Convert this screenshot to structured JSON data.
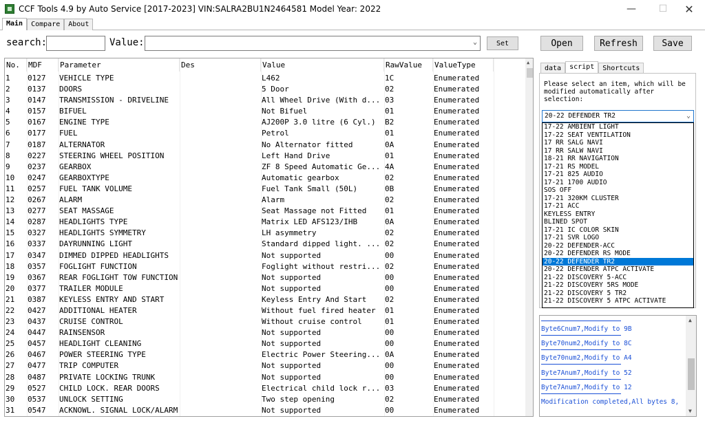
{
  "window": {
    "title": "CCF Tools 4.9 by Auto Service [2017-2023]   VIN:SALRA2BU1N2464581  Model Year: 2022"
  },
  "tabs": [
    "Main",
    "Compare",
    "About"
  ],
  "search": {
    "label": "search:",
    "value": ""
  },
  "value_filter": {
    "label": "Value:",
    "value": ""
  },
  "buttons": {
    "set": "Set",
    "open": "Open",
    "refresh": "Refresh",
    "save": "Save"
  },
  "grid": {
    "columns": [
      "No.",
      "MDF",
      "Parameter",
      "Des",
      "Value",
      "RawValue",
      "ValueType"
    ],
    "rows": [
      [
        "1",
        "0127",
        "VEHICLE TYPE",
        "",
        "L462",
        "1C",
        "Enumerated"
      ],
      [
        "2",
        "0137",
        "DOORS",
        "",
        "5 Door",
        "02",
        "Enumerated"
      ],
      [
        "3",
        "0147",
        "TRANSMISSION  - DRIVELINE",
        "",
        "All Wheel Drive (With d...",
        "03",
        "Enumerated"
      ],
      [
        "4",
        "0157",
        "BIFUEL",
        "",
        "Not Bifuel",
        "01",
        "Enumerated"
      ],
      [
        "5",
        "0167",
        "ENGINE TYPE",
        "",
        "AJ200P 3.0 litre (6 Cyl.)",
        "B2",
        "Enumerated"
      ],
      [
        "6",
        "0177",
        "FUEL",
        "",
        "Petrol",
        "01",
        "Enumerated"
      ],
      [
        "7",
        "0187",
        "ALTERNATOR",
        "",
        "No Alternator fitted",
        "0A",
        "Enumerated"
      ],
      [
        "8",
        "0227",
        "STEERING WHEEL POSITION",
        "",
        "Left Hand Drive",
        "01",
        "Enumerated"
      ],
      [
        "9",
        "0237",
        "GEARBOX",
        "",
        "ZF 8 Speed Automatic Ge...",
        "4A",
        "Enumerated"
      ],
      [
        "10",
        "0247",
        "GEARBOXTYPE",
        "",
        "Automatic gearbox",
        "02",
        "Enumerated"
      ],
      [
        "11",
        "0257",
        "FUEL TANK VOLUME",
        "",
        "Fuel Tank Small (50L)",
        "0B",
        "Enumerated"
      ],
      [
        "12",
        "0267",
        "ALARM",
        "",
        "Alarm",
        "02",
        "Enumerated"
      ],
      [
        "13",
        "0277",
        "SEAT MASSAGE",
        "",
        "Seat Massage not Fitted",
        "01",
        "Enumerated"
      ],
      [
        "14",
        "0287",
        "HEADLIGHTS TYPE",
        "",
        "Matrix LED AFS123/IHB",
        "0A",
        "Enumerated"
      ],
      [
        "15",
        "0327",
        "HEADLIGHTS SYMMETRY",
        "",
        "LH asymmetry",
        "02",
        "Enumerated"
      ],
      [
        "16",
        "0337",
        "DAYRUNNING LIGHT",
        "",
        "Standard dipped light. ...",
        "02",
        "Enumerated"
      ],
      [
        "17",
        "0347",
        "DIMMED DIPPED HEADLIGHTS",
        "",
        "Not supported",
        "00",
        "Enumerated"
      ],
      [
        "18",
        "0357",
        "FOGLIGHT FUNCTION",
        "",
        "Foglight without restri...",
        "02",
        "Enumerated"
      ],
      [
        "19",
        "0367",
        "REAR FOGLIGHT TOW FUNCTION",
        "",
        "Not supported",
        "00",
        "Enumerated"
      ],
      [
        "20",
        "0377",
        "TRAILER MODULE",
        "",
        "Not supported",
        "00",
        "Enumerated"
      ],
      [
        "21",
        "0387",
        "KEYLESS ENTRY AND START",
        "",
        "Keyless Entry And Start",
        "02",
        "Enumerated"
      ],
      [
        "22",
        "0427",
        "ADDITIONAL HEATER",
        "",
        "Without fuel fired heater",
        "01",
        "Enumerated"
      ],
      [
        "23",
        "0437",
        "CRUISE CONTROL",
        "",
        "Without cruise control",
        "01",
        "Enumerated"
      ],
      [
        "24",
        "0447",
        "RAINSENSOR",
        "",
        "Not supported",
        "00",
        "Enumerated"
      ],
      [
        "25",
        "0457",
        "HEADLIGHT CLEANING",
        "",
        "Not supported",
        "00",
        "Enumerated"
      ],
      [
        "26",
        "0467",
        "POWER STEERING TYPE",
        "",
        "Electric Power Steering...",
        "0A",
        "Enumerated"
      ],
      [
        "27",
        "0477",
        "TRIP COMPUTER",
        "",
        "Not supported",
        "00",
        "Enumerated"
      ],
      [
        "28",
        "0487",
        "PRIVATE LOCKING TRUNK",
        "",
        "Not supported",
        "00",
        "Enumerated"
      ],
      [
        "29",
        "0527",
        "CHILD LOCK. REAR DOORS",
        "",
        "Electrical child lock r...",
        "03",
        "Enumerated"
      ],
      [
        "30",
        "0537",
        "UNLOCK SETTING",
        "",
        "Two step opening",
        "02",
        "Enumerated"
      ],
      [
        "31",
        "0547",
        "ACKNOWL. SIGNAL LOCK/ALARM",
        "",
        "Not supported",
        "00",
        "Enumerated"
      ]
    ]
  },
  "right_tabs": [
    "data",
    "script",
    "Shortcuts"
  ],
  "script": {
    "instruction": "Please select an item, which will be\nmodified automatically after\nselection:",
    "selected": "20-22 DEFENDER TR2",
    "options": [
      "17-22 AMBIENT LIGHT",
      "17-22 SEAT VENTILATION",
      "17 RR SALG NAVI",
      "17 RR SALW NAVI",
      "18-21 RR NAVIGATION",
      "17-21 RS MODEL",
      "17-21 825 AUDIO",
      "17-21 1700 AUDIO",
      "SOS OFF",
      "17-21 320KM CLUSTER",
      "17-21 ACC",
      "KEYLESS ENTRY",
      "BLINED SPOT",
      "17-21 IC COLOR SKIN",
      "17-21 SVR LOGO",
      "20-22 DEFENDER-ACC",
      "20-22 DEFENDER RS MODE",
      "20-22 DEFENDER TR2",
      "20-22 DEFENDER ATPC ACTIVATE",
      "21-22 DISCOVERY 5-ACC",
      "21-22 DISCOVERY 5RS MODE",
      "21-22 DISCOVERY 5 TR2",
      "21-22 DISCOVERY 5 ATPC ACTIVATE"
    ]
  },
  "log": [
    "Byte6Cnum7,Modify to 9B",
    "Byte70num2,Modify to 8C",
    "Byte70num2,Modify to A4",
    "Byte7Anum7,Modify to 52",
    "Byte7Anum7,Modify to 12",
    "Modification completed,All bytes 8,"
  ],
  "colors": {
    "selection": "#0078d7",
    "log_text": "#1a4fd6",
    "accent_border": "#1f75cc"
  },
  "icons": [
    "app-icon",
    "minimize-icon",
    "maximize-icon",
    "close-icon",
    "chevron-down-icon",
    "scroll-up-icon",
    "scroll-down-icon"
  ]
}
